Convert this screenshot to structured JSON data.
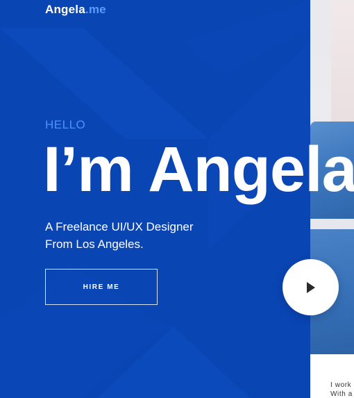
{
  "brand": {
    "name": "Angela",
    "tld": ".me"
  },
  "hero": {
    "greeting": "HELLO",
    "headline": "I’m Angela",
    "tagline_line1": "A Freelance UI/UX Designer",
    "tagline_line2": "From Los Angeles.",
    "cta_label": "HIRE ME",
    "play_icon": "play-icon"
  },
  "about": {
    "line1": "I work",
    "line2": "With a"
  },
  "colors": {
    "hero_bg": "#0a45b4",
    "accent": "#4d93ff",
    "text": "#ffffff"
  }
}
